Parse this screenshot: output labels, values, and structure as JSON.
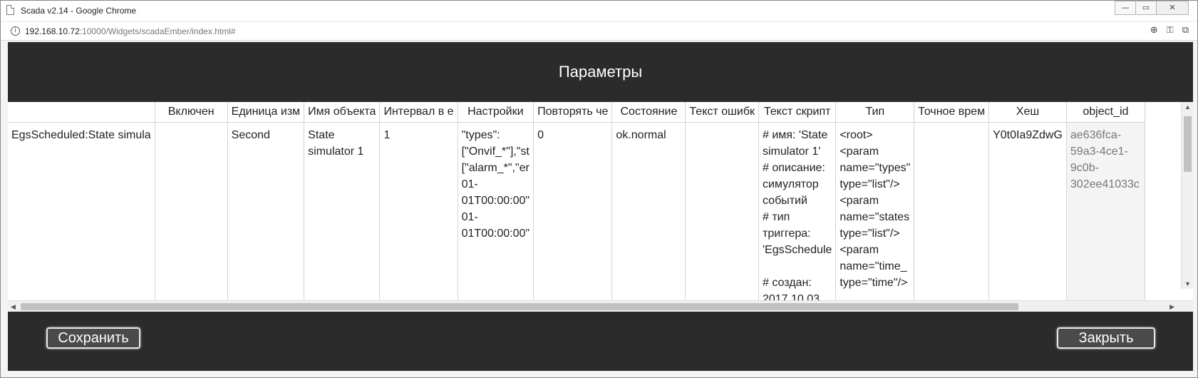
{
  "window": {
    "title": "Scada v2.14 - Google Chrome",
    "buttons": {
      "minimize": "—",
      "restore": "▭",
      "close": "✕"
    }
  },
  "addressbar": {
    "url_host": "192.168.10.72",
    "url_rest": ":10000/Widgets/scadaEmber/index.html#",
    "icons": [
      "zoom-icon",
      "key-icon",
      "translate-icon"
    ]
  },
  "dialog": {
    "title": "Параметры",
    "save_label": "Сохранить",
    "close_label": "Закрыть"
  },
  "table": {
    "columns": [
      "",
      "Включен",
      "Единица изм",
      "Имя объекта",
      "Интервал в е",
      "Настройки",
      "Повторять че",
      "Состояние",
      "Текст ошибк",
      "Текст скрипт",
      "Тип",
      "Точное врем",
      "Хеш",
      "object_id"
    ],
    "row": {
      "name": "EgsScheduled:State simula",
      "enabled": "",
      "unit": "Second",
      "object_name": [
        "State",
        "simulator 1"
      ],
      "interval": "1",
      "settings": [
        "\"types\":",
        "[\"Onvif_*\"],\"st",
        "[\"alarm_*\",\"er",
        "01-",
        "01T00:00:00\"",
        "01-",
        "01T00:00:00\""
      ],
      "repeat": "0",
      "state": "ok.normal",
      "error_text": "",
      "script_text": [
        "# имя: 'State",
        "simulator 1'",
        "# описание:",
        "симулятор",
        "событий",
        "# тип",
        "триггера:",
        "'EgsSchedule",
        "",
        "# создан:",
        "2017.10.03"
      ],
      "type": [
        "<root>",
        "<param",
        "name=\"types\"",
        "type=\"list\"/>",
        "<param",
        "name=\"states",
        "type=\"list\"/>",
        "<param",
        "name=\"time_",
        "type=\"time\"/>"
      ],
      "exact_time": "",
      "hash": "Y0t0Ia9ZdwG",
      "object_id": [
        "ae636fca-",
        "59a3-4ce1-",
        "9c0b-",
        "302ee41033c"
      ]
    }
  }
}
